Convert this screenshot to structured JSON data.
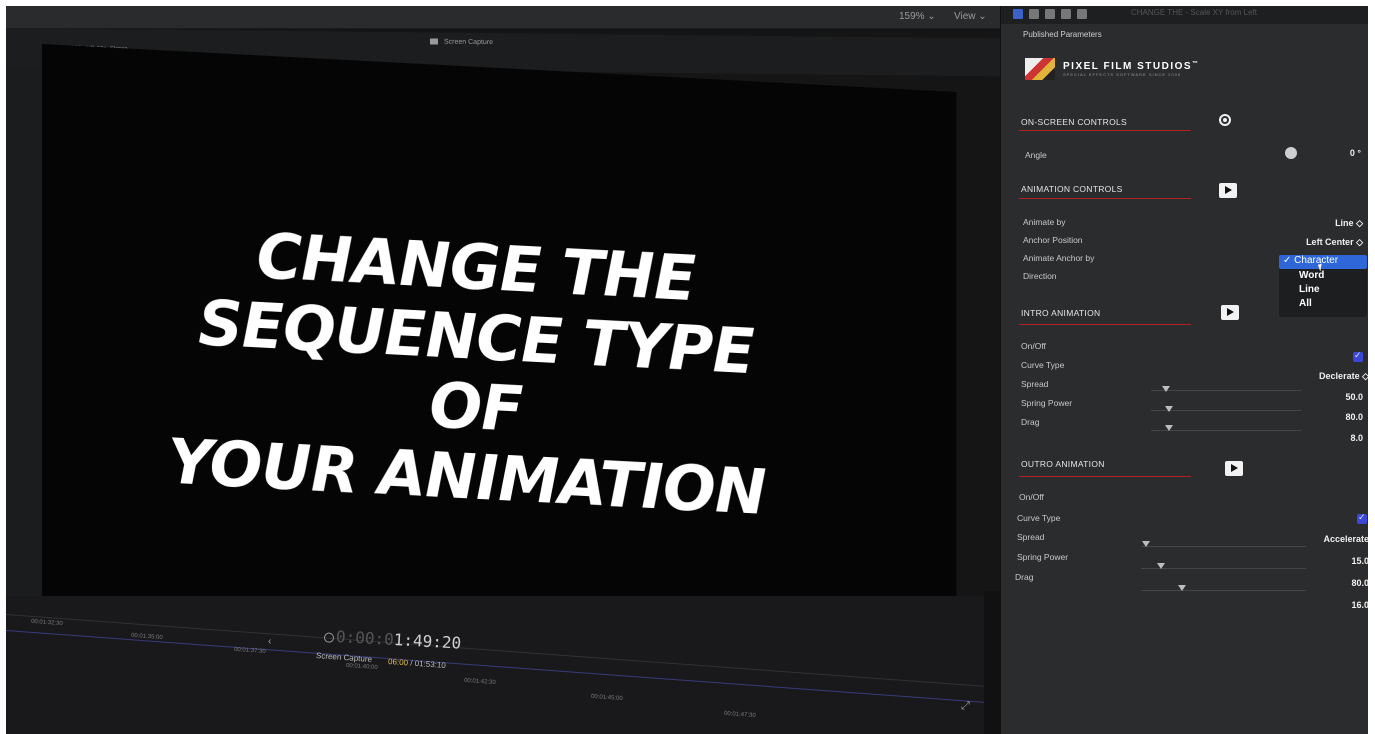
{
  "topbar": {
    "zoom": "159% ⌄",
    "view": "View ⌄"
  },
  "viewer_header": {
    "format": "1080p HD 60p, Stereo",
    "title": "Screen Capture"
  },
  "headline": {
    "line1": "CHANGE THE",
    "line2": "SEQUENCE TYPE OF",
    "line3": "YOUR ANIMATION"
  },
  "inspector": {
    "clip_title": "CHANGE THE - Scale XY from Left",
    "published_parameters": "Published Parameters",
    "logo": {
      "name": "PIXEL FILM STUDIOS",
      "tm": "™",
      "tagline": "SPECIAL EFFECTS SOFTWARE SINCE 2006"
    },
    "onscreen": {
      "title": "ON-SCREEN CONTROLS",
      "angle_label": "Angle",
      "angle_value": "0 °"
    },
    "animation": {
      "title": "ANIMATION CONTROLS",
      "animate_by_label": "Animate by",
      "animate_by_value": "Line ◇",
      "anchor_position_label": "Anchor Position",
      "anchor_position_value": "Left Center ◇",
      "animate_anchor_label": "Animate Anchor by",
      "direction_label": "Direction"
    },
    "dropdown": {
      "selected": "✓ Character",
      "options": [
        "Word",
        "Line",
        "All"
      ]
    },
    "intro": {
      "title": "INTRO ANIMATION",
      "onoff_label": "On/Off",
      "curve_label": "Curve Type",
      "curve_value": "Declerate ◇",
      "spread_label": "Spread",
      "spread_value": "50.0",
      "spring_label": "Spring Power",
      "spring_value": "80.0",
      "drag_label": "Drag",
      "drag_value": "8.0",
      "spread_level": 0.1,
      "spring_level": 0.12,
      "drag_level": 0.12
    },
    "outro": {
      "title": "OUTRO ANIMATION",
      "onoff_label": "On/Off",
      "curve_label": "Curve Type",
      "curve_value": "Accelerate",
      "spread_label": "Spread",
      "spread_value": "15.0",
      "spring_label": "Spring Power",
      "spring_value": "80.0",
      "drag_label": "Drag",
      "drag_value": "16.0",
      "spread_level": 0.03,
      "spring_level": 0.12,
      "drag_level": 0.25
    }
  },
  "timeline": {
    "timecode_dim": "0:00:0",
    "timecode": "1:49:20",
    "clip_name": "Screen Capture",
    "duration_current": "06:00",
    "duration_total": " / 01:53:10",
    "ticks": [
      "00:01:32:30",
      "00:01:35:00",
      "00:01:37:30",
      "00:01:40:00",
      "00:01:42:30",
      "00:01:45:00",
      "00:01:47:30"
    ]
  },
  "colors": {
    "accent_red": "#b32020",
    "selection_blue": "#2f67d8",
    "checkbox_blue": "#3c46d9",
    "timecode_yellow": "#e3c04a"
  }
}
